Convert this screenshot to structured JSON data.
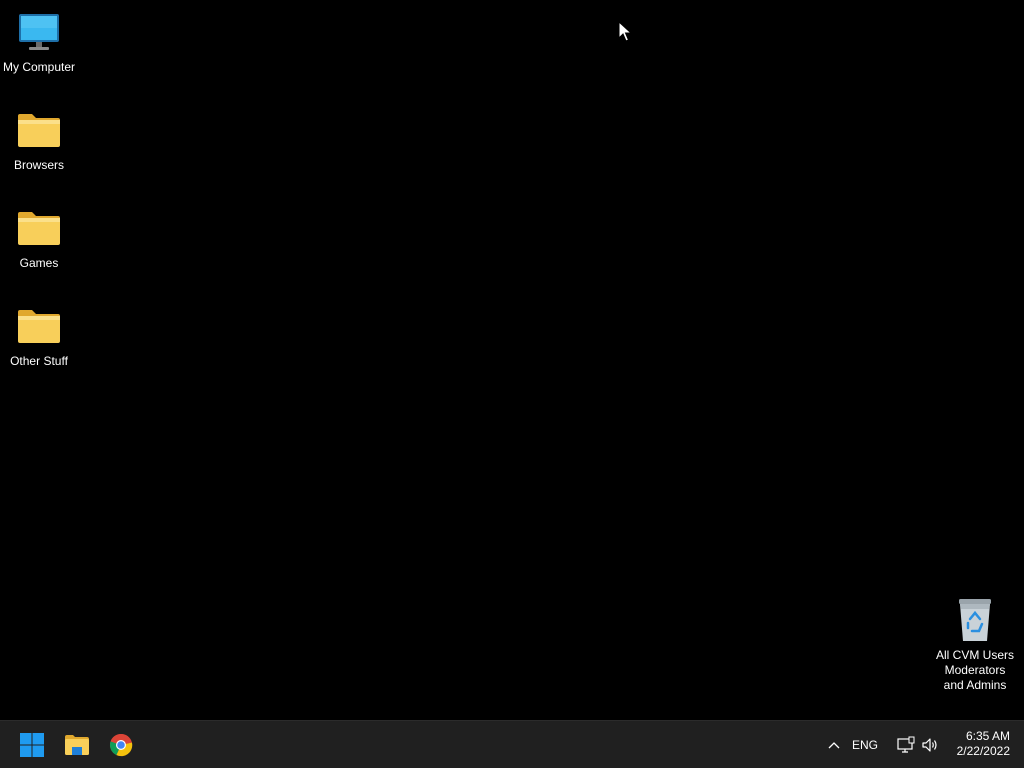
{
  "desktop": {
    "background": "#000000",
    "icons": [
      {
        "label": "My Computer",
        "icon": "monitor-icon"
      },
      {
        "label": "Browsers",
        "icon": "folder-icon"
      },
      {
        "label": "Games",
        "icon": "folder-icon"
      },
      {
        "label": "Other Stuff",
        "icon": "folder-icon"
      }
    ],
    "recycle_bin": {
      "label": "All CVM Users\nModerators\nand Admins",
      "icon": "recycle-bin-icon"
    }
  },
  "taskbar": {
    "background": "#202020",
    "pinned": [
      {
        "name": "start",
        "icon": "windows-logo-icon"
      },
      {
        "name": "file-explorer",
        "icon": "folder-icon"
      },
      {
        "name": "chrome",
        "icon": "chrome-icon"
      }
    ],
    "tray": {
      "language": "ENG",
      "time": "6:35 AM",
      "date": "2/22/2022"
    }
  },
  "colors": {
    "folder": "#f4c542",
    "windows_blue": "#0078d4",
    "monitor_blue": "#29a3e0"
  }
}
